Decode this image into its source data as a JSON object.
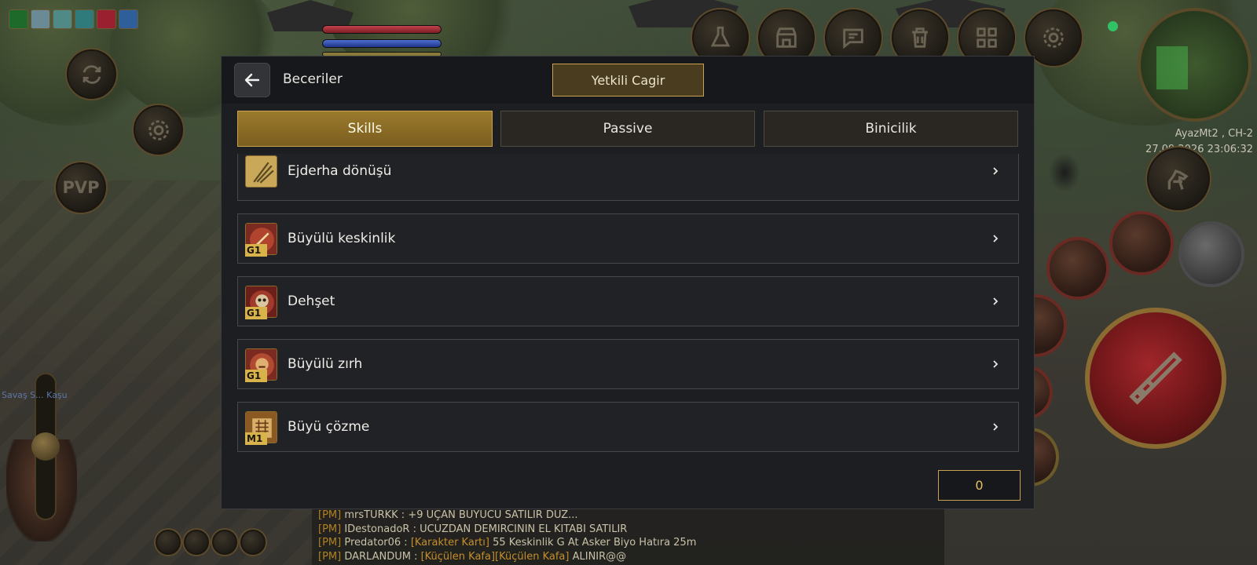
{
  "hud": {
    "pvp_label": "PVP",
    "server": "AyazMt2 , CH-2",
    "clock": "27.09.2026 23:06:32",
    "world_label": "Savaş S... Kaşu"
  },
  "dialog": {
    "title": "Beceriler",
    "call_gm_label": "Yetkili Cagir",
    "tabs": [
      {
        "label": "Skills",
        "active": true
      },
      {
        "label": "Passive",
        "active": false
      },
      {
        "label": "Binicilik",
        "active": false
      }
    ],
    "skills": [
      {
        "name": "Ejderha dönüşü",
        "grade": "",
        "icon": "dragon-claw-icon"
      },
      {
        "name": "Büyülü keskinlik",
        "grade": "G1",
        "icon": "enchanted-sword-icon"
      },
      {
        "name": "Dehşet",
        "grade": "G1",
        "icon": "skull-icon"
      },
      {
        "name": "Büyülü zırh",
        "grade": "G1",
        "icon": "lion-armor-icon"
      },
      {
        "name": "Büyü çözme",
        "grade": "M1",
        "icon": "dispel-scroll-icon"
      }
    ],
    "skill_points": "0"
  },
  "chat": [
    {
      "tag": "[PM]",
      "nick": "mrsTURKK :",
      "segments": [
        {
          "text": "+9 UÇAN BÜYÜCÜ SATILIR DÜZ...",
          "item": false
        }
      ]
    },
    {
      "tag": "[PM]",
      "nick": "IDestonadoR :",
      "segments": [
        {
          "text": "UCUZDAN DEMIRCININ EL KITABI SATILIR",
          "item": false
        }
      ]
    },
    {
      "tag": "[PM]",
      "nick": "Predator06 :",
      "segments": [
        {
          "text": "[Karakter Kartı]",
          "item": true
        },
        {
          "text": " 55 Keskinlik G At Asker Biyo Hatıra 25m",
          "item": false
        }
      ]
    },
    {
      "tag": "[PM]",
      "nick": "DARLANDUM :",
      "segments": [
        {
          "text": "[Küçülen Kafa][Küçülen Kafa]",
          "item": true
        },
        {
          "text": " ALINIR@@",
          "item": false
        }
      ]
    }
  ],
  "colors": {
    "accent_gold": "#c9a250",
    "active_tab": "#8b6c26",
    "panel_bg": "#1d1e22",
    "pm_tag": "#b1821f",
    "online": "#31c266"
  }
}
